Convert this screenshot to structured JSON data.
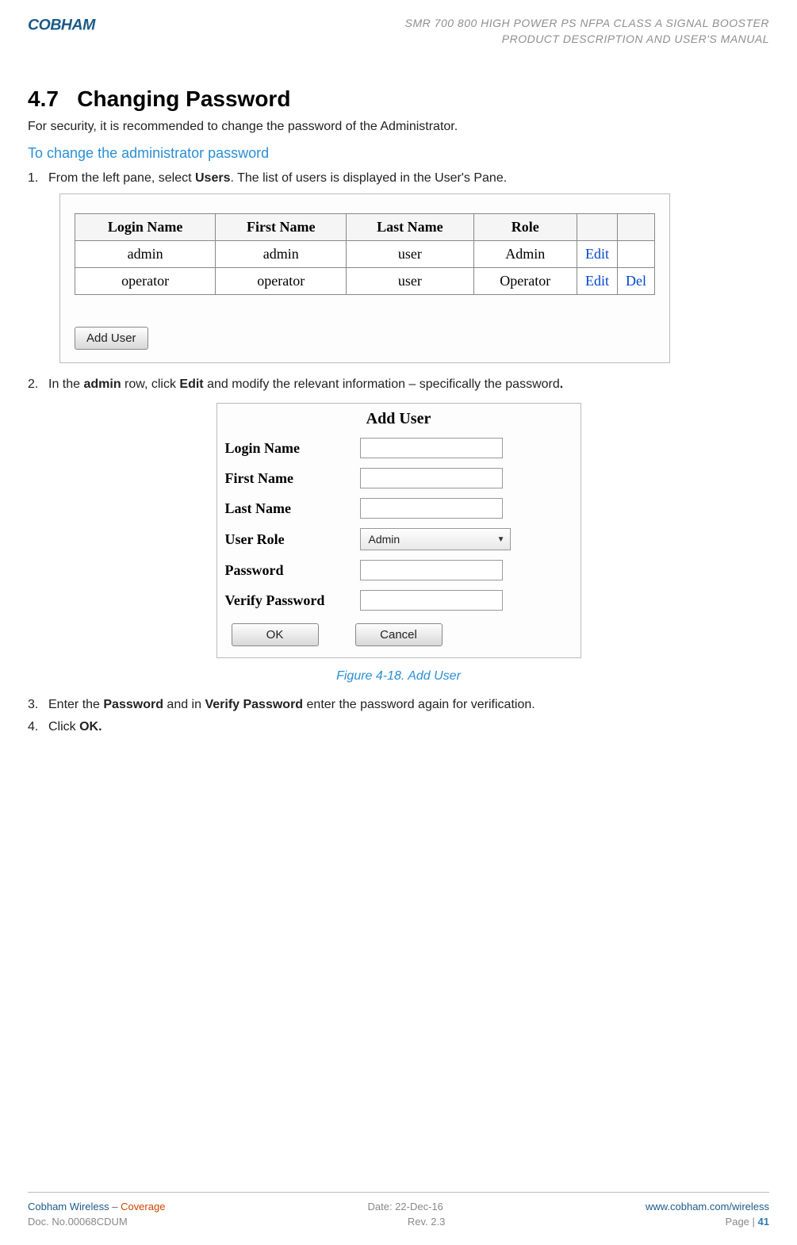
{
  "header": {
    "logo_text": "COBHAM",
    "line1": "SMR 700 800 HIGH POWER PS NFPA CLASS A SIGNAL BOOSTER",
    "line2": "PRODUCT DESCRIPTION AND USER'S MANUAL"
  },
  "section": {
    "number": "4.7",
    "title": "Changing Password",
    "intro": "For security, it is recommended to change the password of the Administrator."
  },
  "subheading": "To change the administrator password",
  "step1": {
    "num": "1.",
    "prefix": "From the left pane, select ",
    "bold1": "Users",
    "suffix": ". The list of users is displayed in the User's Pane."
  },
  "users_table": {
    "headers": [
      "Login Name",
      "First Name",
      "Last Name",
      "Role"
    ],
    "rows": [
      {
        "login": "admin",
        "first": "admin",
        "last": "user",
        "role": "Admin",
        "edit": "Edit",
        "del": ""
      },
      {
        "login": "operator",
        "first": "operator",
        "last": "user",
        "role": "Operator",
        "edit": "Edit",
        "del": "Del"
      }
    ],
    "add_user_btn": "Add User"
  },
  "step2": {
    "num": "2.",
    "prefix": "In the ",
    "bold1": "admin",
    "mid": " row, click ",
    "bold2": "Edit",
    "suffix": " and modify the relevant information – specifically the password",
    "period": "."
  },
  "add_user_dialog": {
    "title": "Add User",
    "login_name": "Login Name",
    "first_name": "First Name",
    "last_name": "Last Name",
    "user_role": "User Role",
    "user_role_value": "Admin",
    "password": "Password",
    "verify_password": "Verify Password",
    "ok": "OK",
    "cancel": "Cancel"
  },
  "figure_caption": "Figure 4-18. Add User",
  "step3": {
    "num": "3.",
    "prefix": "Enter the ",
    "bold1": "Password",
    "mid": " and in ",
    "bold2": "Verify Password",
    "suffix": " enter the password again for verification."
  },
  "step4": {
    "num": "4.",
    "prefix": "Click ",
    "bold1": "OK."
  },
  "footer": {
    "brand": "Cobham Wireless",
    "dash": " – ",
    "coverage": "Coverage",
    "date": "Date: 22-Dec-16",
    "url": "www.cobham.com/wireless",
    "doc": "Doc. No.00068CDUM",
    "rev": "Rev. 2.3",
    "page_label": "Page | ",
    "page_num": "41"
  }
}
